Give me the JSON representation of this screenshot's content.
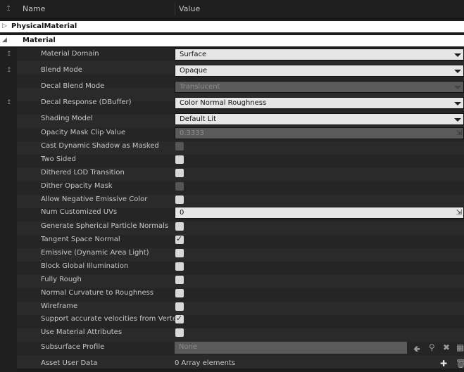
{
  "header": {
    "name_label": "Name",
    "value_label": "Value"
  },
  "categories": {
    "physical": "PhysicalMaterial",
    "material": "Material"
  },
  "rows": {
    "material_domain": {
      "label": "Material Domain",
      "value": "Surface"
    },
    "blend_mode": {
      "label": "Blend Mode",
      "value": "Opaque"
    },
    "decal_blend_mode": {
      "label": "Decal Blend Mode",
      "value": "Translucent"
    },
    "decal_response": {
      "label": "Decal Response (DBuffer)",
      "value": "Color Normal Roughness"
    },
    "shading_model": {
      "label": "Shading Model",
      "value": "Default Lit"
    },
    "opacity_mask_clip": {
      "label": "Opacity Mask Clip Value",
      "value": "0.3333"
    },
    "cast_dynamic_shadow": {
      "label": "Cast Dynamic Shadow as Masked"
    },
    "two_sided": {
      "label": "Two Sided"
    },
    "dithered_lod": {
      "label": "Dithered LOD Transition"
    },
    "dither_opacity": {
      "label": "Dither Opacity Mask"
    },
    "allow_negative_emissive": {
      "label": "Allow Negative Emissive Color"
    },
    "num_customized_uvs": {
      "label": "Num Customized UVs",
      "value": "0"
    },
    "generate_spherical": {
      "label": "Generate Spherical Particle Normals"
    },
    "tangent_space_normal": {
      "label": "Tangent Space Normal",
      "checked": true
    },
    "emissive_dynamic": {
      "label": "Emissive (Dynamic Area Light)"
    },
    "block_gi": {
      "label": "Block Global Illumination"
    },
    "fully_rough": {
      "label": "Fully Rough"
    },
    "normal_curvature": {
      "label": "Normal Curvature to Roughness"
    },
    "wireframe": {
      "label": "Wireframe"
    },
    "support_velocities": {
      "label": "Support accurate velocities from Vertex Deformation",
      "checked": true
    },
    "use_material_attributes": {
      "label": "Use Material Attributes"
    },
    "subsurface_profile": {
      "label": "Subsurface Profile",
      "value": "None"
    },
    "asset_user_data": {
      "label": "Asset User Data",
      "value": "0 Array elements"
    }
  },
  "colors": {
    "background": "#1b1b1b",
    "field": "#e6e6e6",
    "disabled_field": "#5a5a5a",
    "category": "#ffffff"
  },
  "icons": {
    "pin": "pin-icon",
    "use_selected": "arrow-left-icon",
    "browse": "search-icon",
    "clear": "close-icon",
    "add": "plus-icon",
    "delete": "trash-icon"
  }
}
